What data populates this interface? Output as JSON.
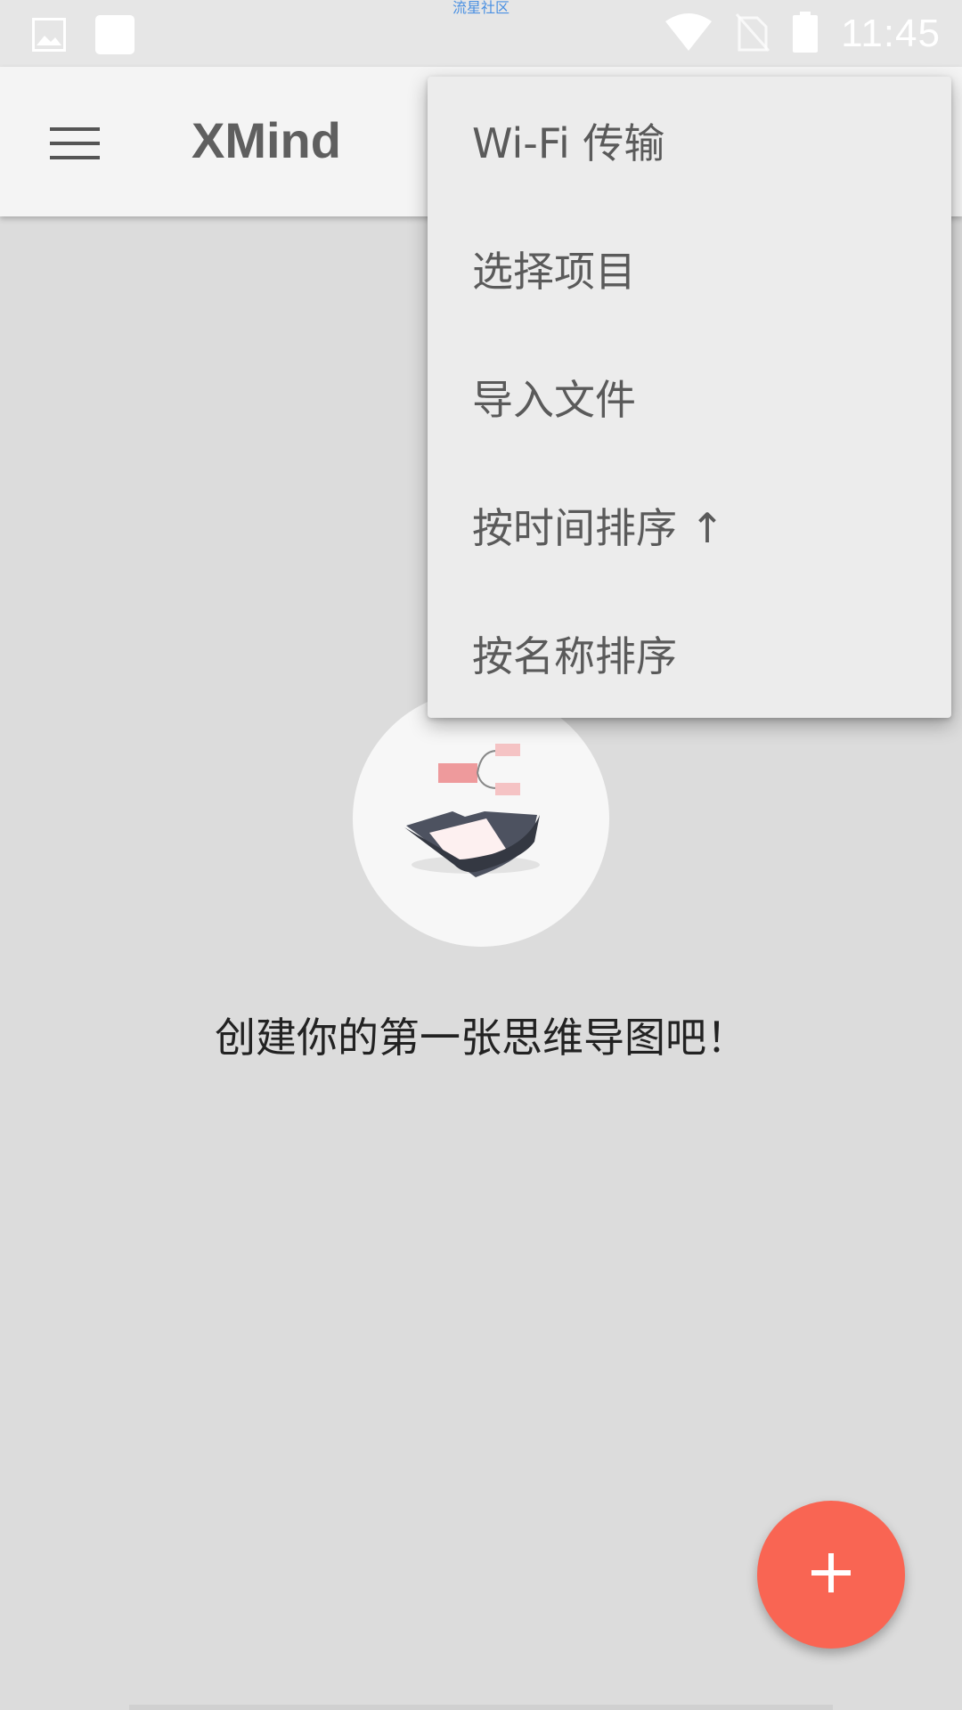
{
  "status_bar": {
    "watermark": "流星社区",
    "time": "11:45",
    "icons": [
      "image-icon",
      "notification-square-icon",
      "wifi-icon",
      "no-sim-icon",
      "battery-icon"
    ]
  },
  "app_bar": {
    "title": "XMind",
    "menu_icon": "hamburger-menu-icon"
  },
  "overflow_menu": {
    "items": [
      {
        "label": "Wi-Fi 传输"
      },
      {
        "label": "选择项目"
      },
      {
        "label": "导入文件"
      },
      {
        "label": "按时间排序 ↑"
      },
      {
        "label": "按名称排序"
      }
    ]
  },
  "empty_state": {
    "illustration": "empty-folder-mindmap-icon",
    "message": "创建你的第一张思维导图吧！"
  },
  "fab": {
    "icon": "plus-icon"
  },
  "colors": {
    "accent": "#f96553",
    "background": "#dcdcdc",
    "app_bar": "#f4f4f4",
    "menu_bg": "#ececec",
    "title_text": "#5f5f5f"
  }
}
